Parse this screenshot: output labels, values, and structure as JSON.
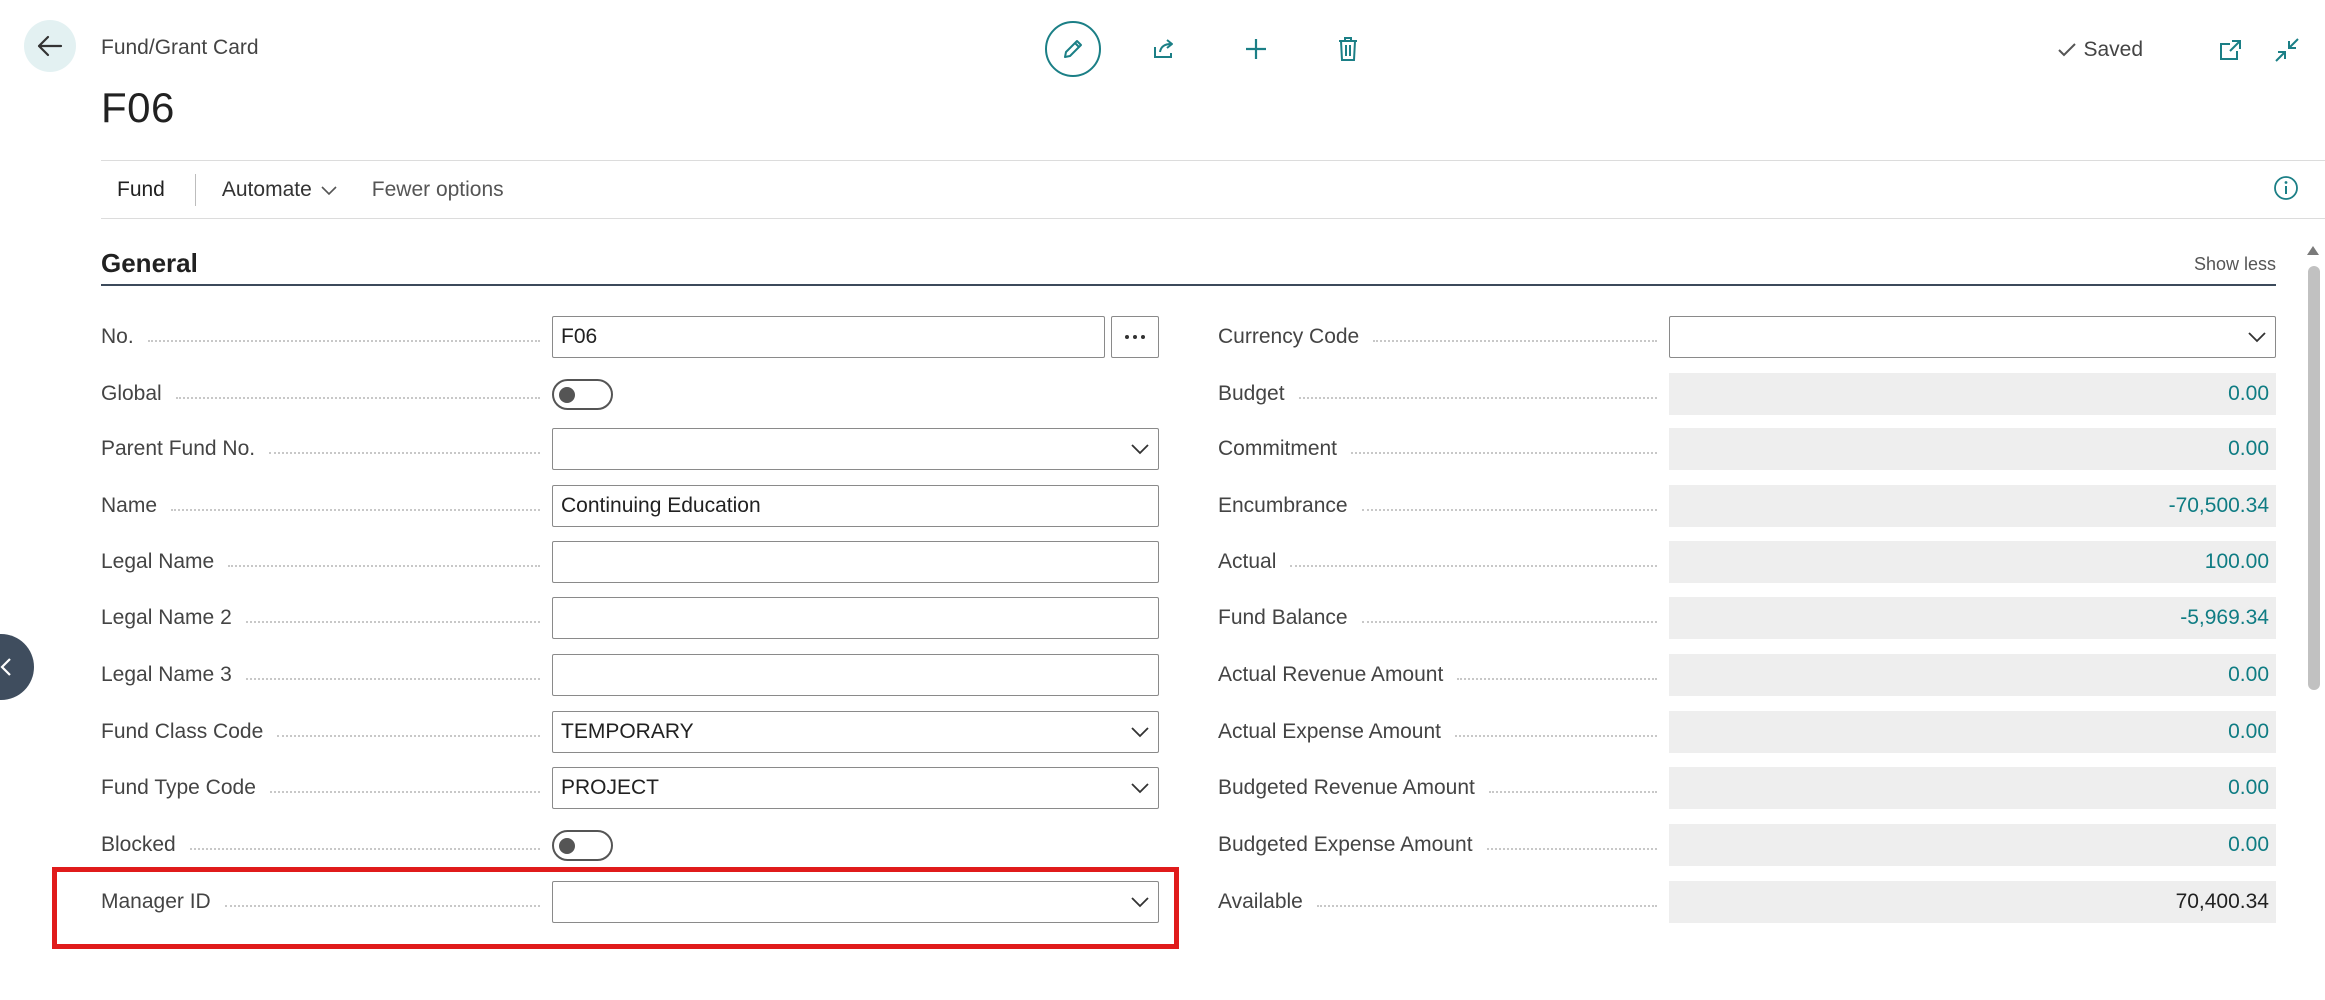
{
  "header": {
    "breadcrumb": "Fund/Grant Card",
    "title": "F06",
    "status": "Saved"
  },
  "actions": {
    "fund": "Fund",
    "automate": "Automate",
    "fewer_options": "Fewer options"
  },
  "section": {
    "title": "General",
    "show_less": "Show less"
  },
  "left_fields": {
    "no": {
      "label": "No.",
      "value": "F06"
    },
    "global": {
      "label": "Global",
      "value": "off"
    },
    "parent_fund_no": {
      "label": "Parent Fund No.",
      "value": ""
    },
    "name": {
      "label": "Name",
      "value": "Continuing Education"
    },
    "legal_name": {
      "label": "Legal Name",
      "value": ""
    },
    "legal_name_2": {
      "label": "Legal Name 2",
      "value": ""
    },
    "legal_name_3": {
      "label": "Legal Name 3",
      "value": ""
    },
    "fund_class_code": {
      "label": "Fund Class Code",
      "value": "TEMPORARY"
    },
    "fund_type_code": {
      "label": "Fund Type Code",
      "value": "PROJECT"
    },
    "blocked": {
      "label": "Blocked",
      "value": "off"
    },
    "manager_id": {
      "label": "Manager ID",
      "value": ""
    }
  },
  "right_fields": {
    "currency_code": {
      "label": "Currency Code",
      "value": ""
    },
    "budget": {
      "label": "Budget",
      "value": "0.00"
    },
    "commitment": {
      "label": "Commitment",
      "value": "0.00"
    },
    "encumbrance": {
      "label": "Encumbrance",
      "value": "-70,500.34"
    },
    "actual": {
      "label": "Actual",
      "value": "100.00"
    },
    "fund_balance": {
      "label": "Fund Balance",
      "value": "-5,969.34"
    },
    "actual_revenue_amount": {
      "label": "Actual Revenue Amount",
      "value": "0.00"
    },
    "actual_expense_amount": {
      "label": "Actual Expense Amount",
      "value": "0.00"
    },
    "budgeted_revenue_amount": {
      "label": "Budgeted Revenue Amount",
      "value": "0.00"
    },
    "budgeted_expense_amount": {
      "label": "Budgeted Expense Amount",
      "value": "0.00"
    },
    "available": {
      "label": "Available",
      "value": "70,400.34"
    }
  },
  "colors": {
    "accent": "#1b7f86",
    "highlight": "#e01b1b",
    "readonly_bg": "#eeeeee"
  },
  "icons": [
    "back-arrow-icon",
    "pencil-icon",
    "share-icon",
    "plus-icon",
    "trash-icon",
    "checkmark-icon",
    "open-in-new-window-icon",
    "collapse-icon",
    "info-icon",
    "ellipsis-icon",
    "chevron-down-icon",
    "chevron-left-icon"
  ]
}
